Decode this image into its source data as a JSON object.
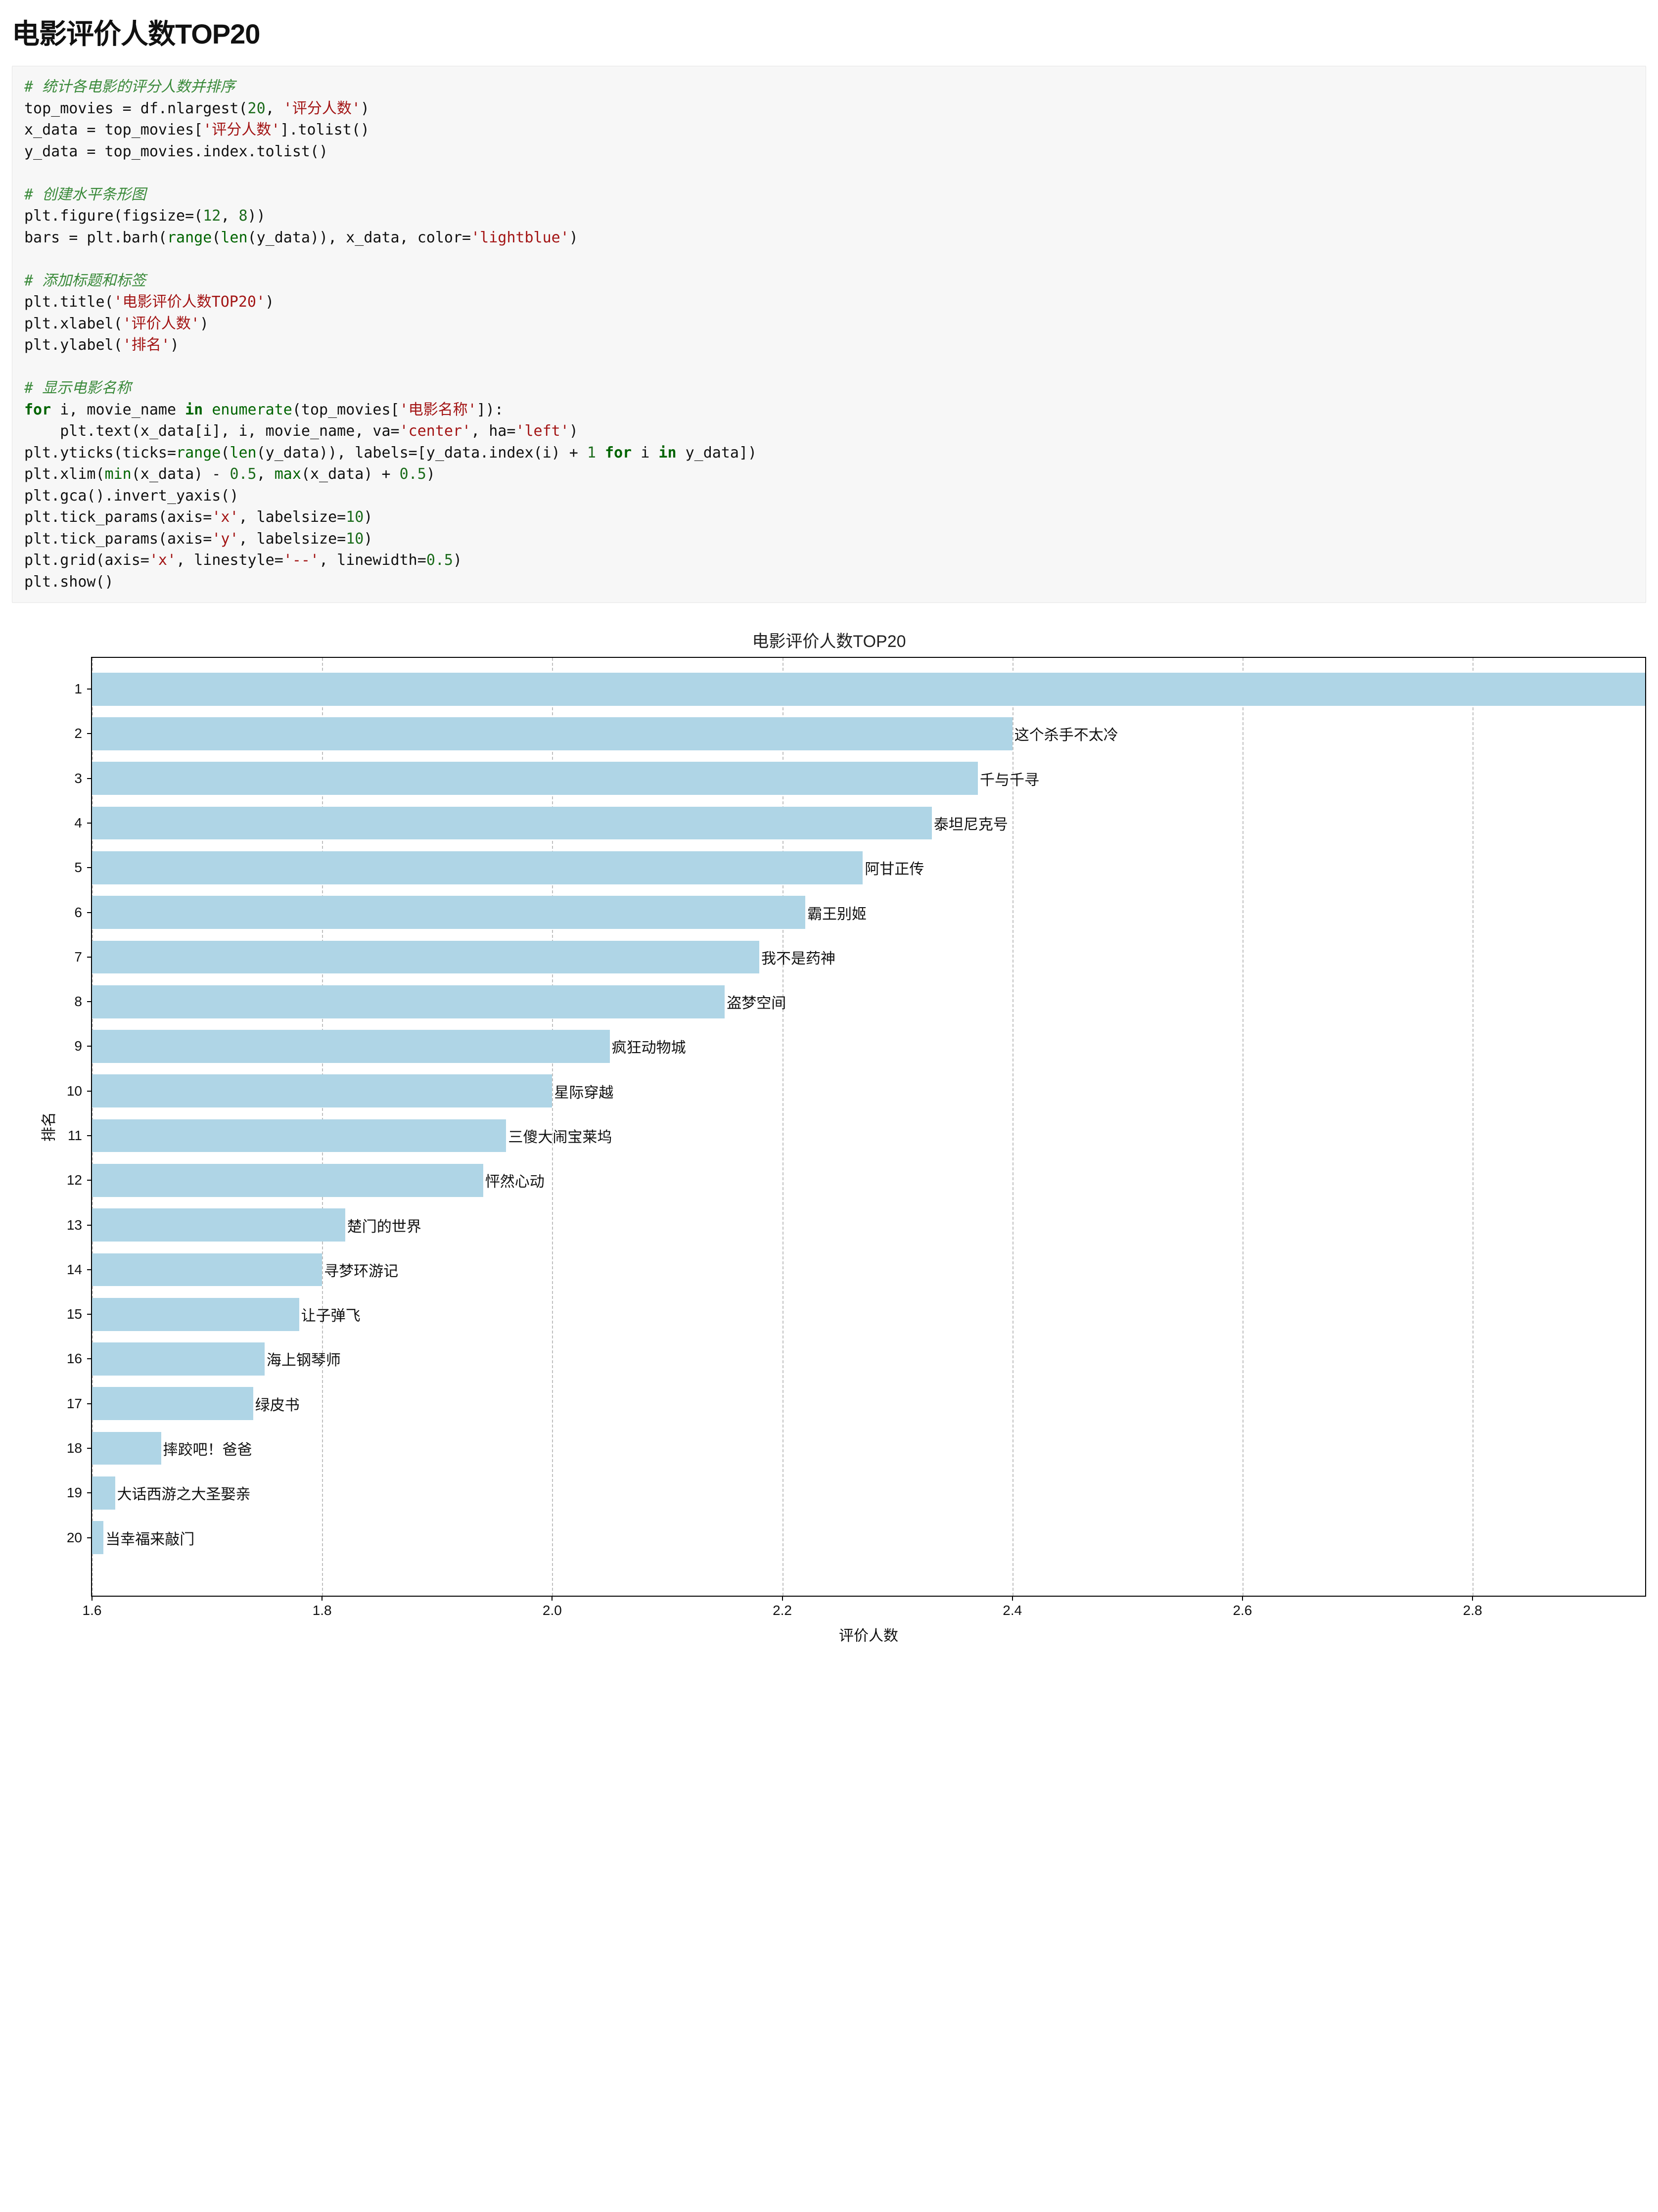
{
  "page_title": "电影评价人数TOP20",
  "code": {
    "c1": "# 统计各电影的评分人数并排序",
    "l1a": "top_movies = df.nlargest(",
    "l1n": "20",
    "l1b": ", ",
    "l1s": "'评分人数'",
    "l1c": ")",
    "l2a": "x_data = top_movies[",
    "l2s": "'评分人数'",
    "l2b": "].tolist()",
    "l3": "y_data = top_movies.index.tolist()",
    "c2": "# 创建水平条形图",
    "l4a": "plt.figure(figsize=(",
    "l4n1": "12",
    "l4m": ", ",
    "l4n2": "8",
    "l4b": "))",
    "l5a": "bars = plt.barh(",
    "l5r": "range",
    "l5b": "(",
    "l5len": "len",
    "l5c": "(y_data)), x_data, color=",
    "l5s": "'lightblue'",
    "l5d": ")",
    "c3": "# 添加标题和标签",
    "l6a": "plt.title(",
    "l6s": "'电影评价人数TOP20'",
    "l6b": ")",
    "l7a": "plt.xlabel(",
    "l7s": "'评价人数'",
    "l7b": ")",
    "l8a": "plt.ylabel(",
    "l8s": "'排名'",
    "l8b": ")",
    "c4": "# 显示电影名称",
    "l9for": "for",
    "l9a": " i, movie_name ",
    "l9in": "in",
    "l9b": " ",
    "l9enum": "enumerate",
    "l9c": "(top_movies[",
    "l9s": "'电影名称'",
    "l9d": "]):",
    "l10a": "    plt.text(x_data[i], i, movie_name, va=",
    "l10s1": "'center'",
    "l10b": ", ha=",
    "l10s2": "'left'",
    "l10c": ")",
    "l11a": "plt.yticks(ticks=",
    "l11r": "range",
    "l11b": "(",
    "l11len": "len",
    "l11c": "(y_data)), labels=[y_data.index(i) + ",
    "l11n": "1",
    "l11d": " ",
    "l11for": "for",
    "l11e": " i ",
    "l11in": "in",
    "l11f": " y_data])",
    "l12a": "plt.xlim(",
    "l12min": "min",
    "l12b": "(x_data) - ",
    "l12n1": "0.5",
    "l12c": ", ",
    "l12max": "max",
    "l12d": "(x_data) + ",
    "l12n2": "0.5",
    "l12e": ")",
    "l13": "plt.gca().invert_yaxis()",
    "l14a": "plt.tick_params(axis=",
    "l14s": "'x'",
    "l14b": ", labelsize=",
    "l14n": "10",
    "l14c": ")",
    "l15a": "plt.tick_params(axis=",
    "l15s": "'y'",
    "l15b": ", labelsize=",
    "l15n": "10",
    "l15c": ")",
    "l16a": "plt.grid(axis=",
    "l16s": "'x'",
    "l16b": ", linestyle=",
    "l16s2": "'--'",
    "l16c": ", linewidth=",
    "l16n": "0.5",
    "l16d": ")",
    "l17": "plt.show()"
  },
  "chart_data": {
    "type": "bar",
    "orientation": "horizontal",
    "title": "电影评价人数TOP20",
    "xlabel": "评价人数",
    "ylabel": "排名",
    "xlim": [
      1.6,
      2.95
    ],
    "xticks": [
      1.6,
      1.8,
      2.0,
      2.2,
      2.4,
      2.6,
      2.8
    ],
    "bar_color": "#afd5e6",
    "categories": [
      "1",
      "2",
      "3",
      "4",
      "5",
      "6",
      "7",
      "8",
      "9",
      "10",
      "11",
      "12",
      "13",
      "14",
      "15",
      "16",
      "17",
      "18",
      "19",
      "20"
    ],
    "series": [
      {
        "name": "评价人数",
        "values": [
          2.95,
          2.4,
          2.37,
          2.33,
          2.27,
          2.22,
          2.18,
          2.15,
          2.05,
          2.0,
          1.96,
          1.94,
          1.82,
          1.8,
          1.78,
          1.75,
          1.74,
          1.66,
          1.62,
          1.61
        ]
      }
    ],
    "bar_labels": [
      "",
      "这个杀手不太冷",
      "千与千寻",
      "泰坦尼克号",
      "阿甘正传",
      "霸王别姬",
      "我不是药神",
      "盗梦空间",
      "疯狂动物城",
      "星际穿越",
      "三傻大闹宝莱坞",
      "怦然心动",
      "楚门的世界",
      "寻梦环游记",
      "让子弹飞",
      "海上钢琴师",
      "绿皮书",
      "摔跤吧！爸爸",
      "大话西游之大圣娶亲",
      "当幸福来敲门"
    ]
  }
}
